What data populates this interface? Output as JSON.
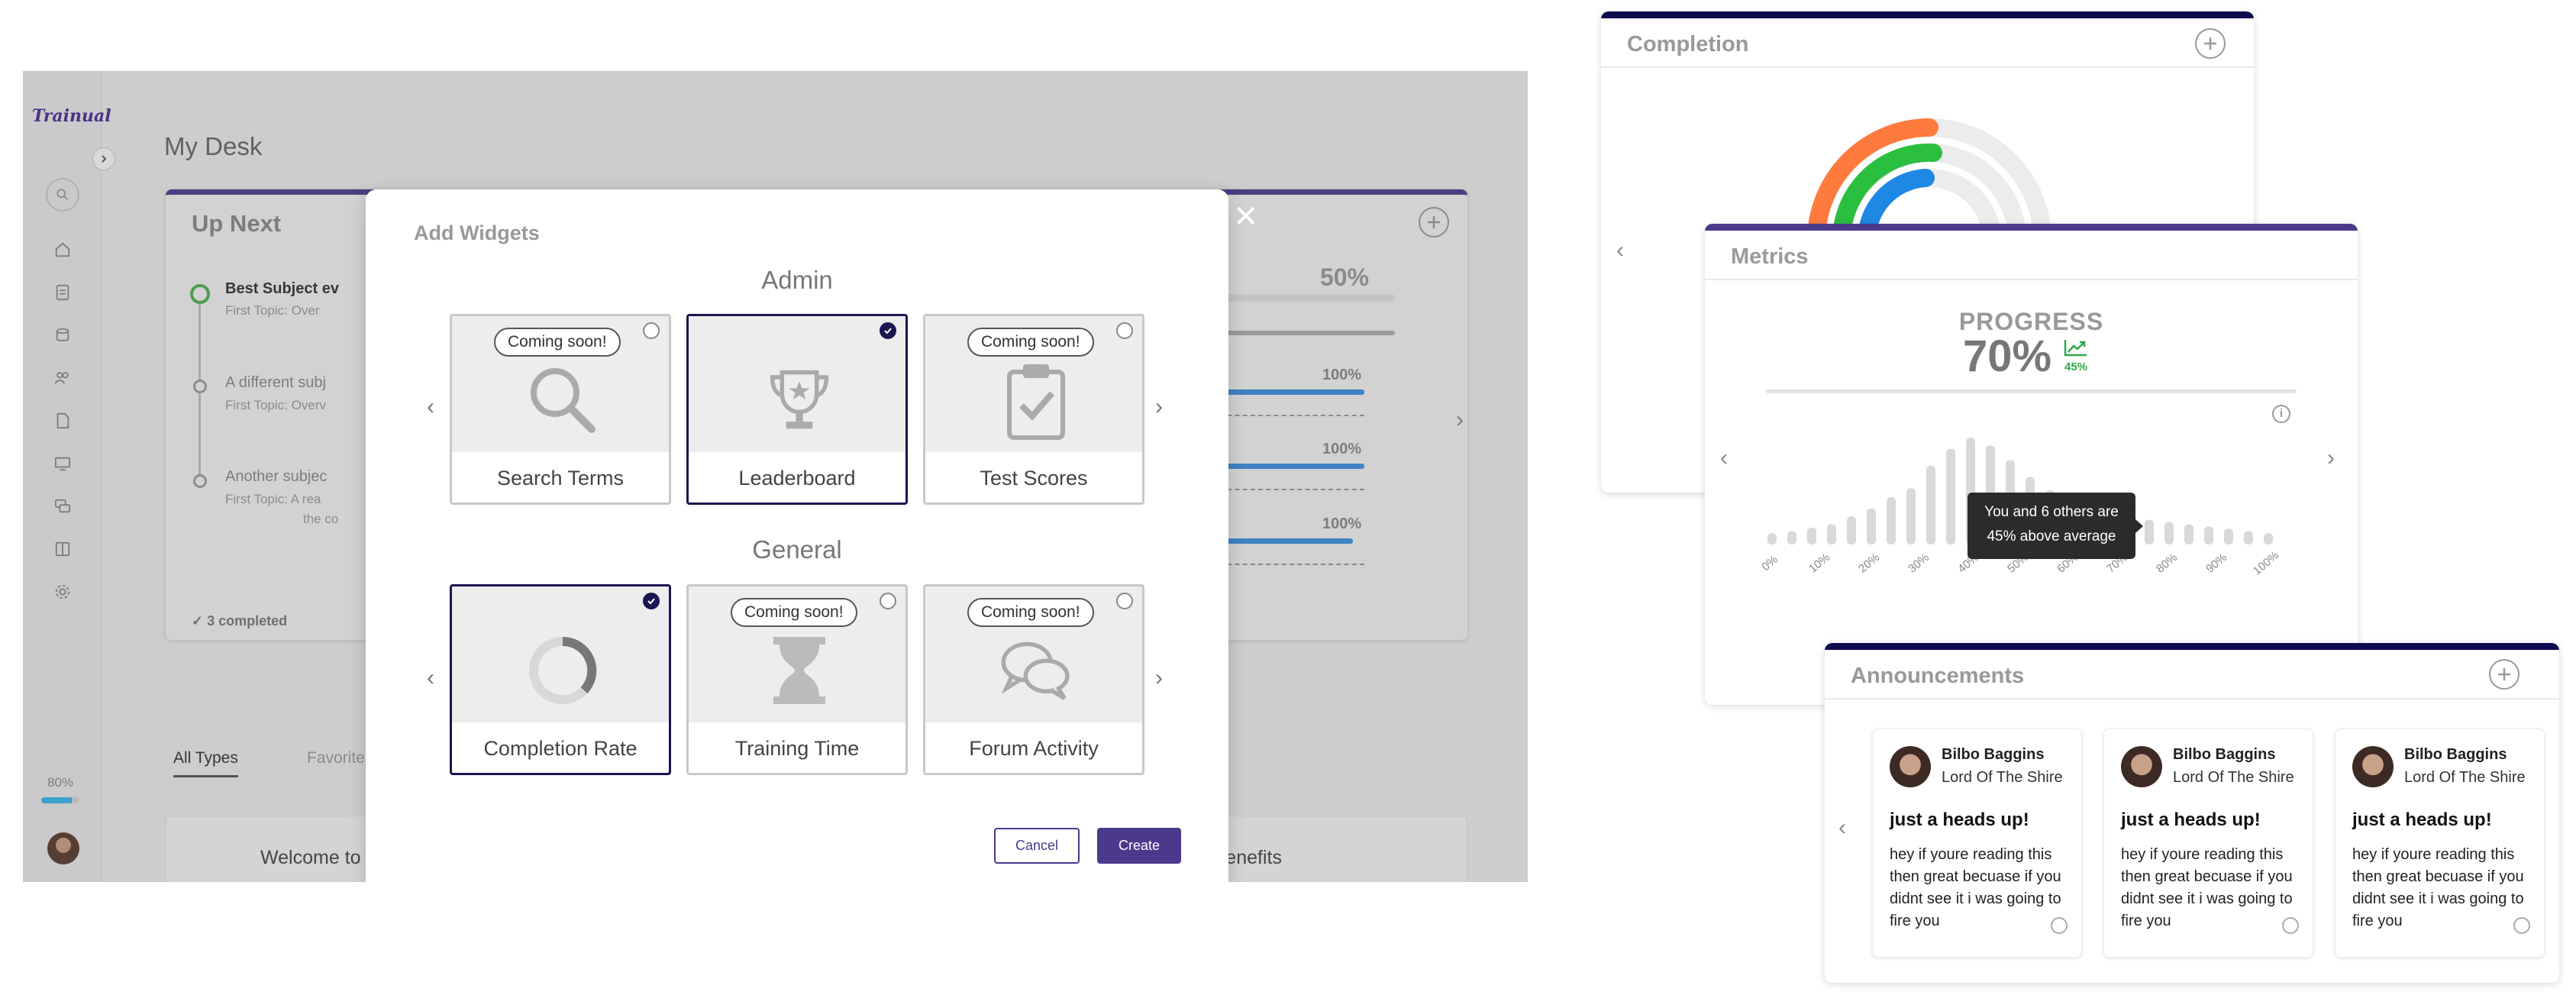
{
  "app": {
    "logo": "Trainual",
    "page_title": "My Desk",
    "sidebar_progress": "80%",
    "sidebar_progress_fraction": 0.8,
    "sidebar_icons": [
      "home-icon",
      "document-icon",
      "layers-icon",
      "people-icon",
      "file-icon",
      "monitor-icon",
      "chat-icon",
      "book-icon",
      "gear-icon"
    ]
  },
  "upnext": {
    "title": "Up Next",
    "items": [
      {
        "title": "Best Subject ev",
        "sub": "First Topic: Over"
      },
      {
        "title": "A different subj",
        "sub": "First Topic: Overv"
      },
      {
        "title": "Another subjec",
        "sub": "First Topic: A rea",
        "sub2": "the co"
      }
    ],
    "completed": "3 completed",
    "main_pct": "50%",
    "sub_pcts": [
      "100%",
      "100%",
      "100%"
    ]
  },
  "tabs": {
    "all": "All Types",
    "favorites": "Favorites"
  },
  "content_cards": [
    "Welcome to Dunder Mifflin!",
    "Employee Handbook, Policies + Benefits"
  ],
  "modal": {
    "title": "Add Widgets",
    "close": "✕",
    "admin_title": "Admin",
    "general_title": "General",
    "coming_soon": "Coming soon!",
    "admin_widgets": [
      {
        "label": "Search Terms",
        "coming_soon": true,
        "selected": false
      },
      {
        "label": "Leaderboard",
        "coming_soon": false,
        "selected": true
      },
      {
        "label": "Test Scores",
        "coming_soon": true,
        "selected": false
      }
    ],
    "general_widgets": [
      {
        "label": "Completion Rate",
        "coming_soon": false,
        "selected": true
      },
      {
        "label": "Training Time",
        "coming_soon": true,
        "selected": false
      },
      {
        "label": "Forum Activity",
        "coming_soon": true,
        "selected": false
      }
    ],
    "cancel": "Cancel",
    "create": "Create"
  },
  "completion_widget": {
    "title": "Completion"
  },
  "metrics_widget": {
    "title": "Metrics",
    "progress_label": "PROGRESS",
    "progress_value": "70%",
    "trend_value": "45%",
    "tooltip_line1": "You and 6 others are",
    "tooltip_line2": "45% above average",
    "highlight_bar_index": 18
  },
  "chart_data": {
    "type": "bar",
    "x_tick_labels": [
      "0%",
      "10%",
      "20%",
      "30%",
      "40%",
      "50%",
      "60%",
      "70%",
      "80%",
      "90%",
      "100%"
    ],
    "values": [
      1,
      1.2,
      1.5,
      1.8,
      2.5,
      3.2,
      4.2,
      5,
      7,
      8.5,
      9.5,
      8.8,
      7.5,
      6,
      4.8,
      4,
      3.2,
      2.6,
      2.4,
      2.2,
      2,
      1.8,
      1.6,
      1.4,
      1.2,
      1
    ],
    "highlight_index": 18,
    "colors": {
      "bar": "#d9d9d9",
      "highlight": "#2196f3"
    }
  },
  "announcements_widget": {
    "title": "Announcements",
    "cards": [
      {
        "name": "Bilbo Baggins",
        "role": "Lord Of The Shire",
        "heading": "just a heads up!",
        "body": "hey if youre reading this then great becuase if you didnt see it i was going to fire you"
      },
      {
        "name": "Bilbo Baggins",
        "role": "Lord Of The Shire",
        "heading": "just a heads up!",
        "body": "hey if youre reading this then great becuase if you didnt see it i was going to fire you"
      },
      {
        "name": "Bilbo Baggins",
        "role": "Lord Of The Shire",
        "heading": "just a heads up!",
        "body": "hey if youre reading this then great becuase if you didnt see it i was going to fire you"
      }
    ]
  },
  "colors": {
    "brand": "#4b3a8c",
    "selected_border": "#1a1650",
    "accent_blue": "#2196f3",
    "green": "#2ea84a"
  }
}
